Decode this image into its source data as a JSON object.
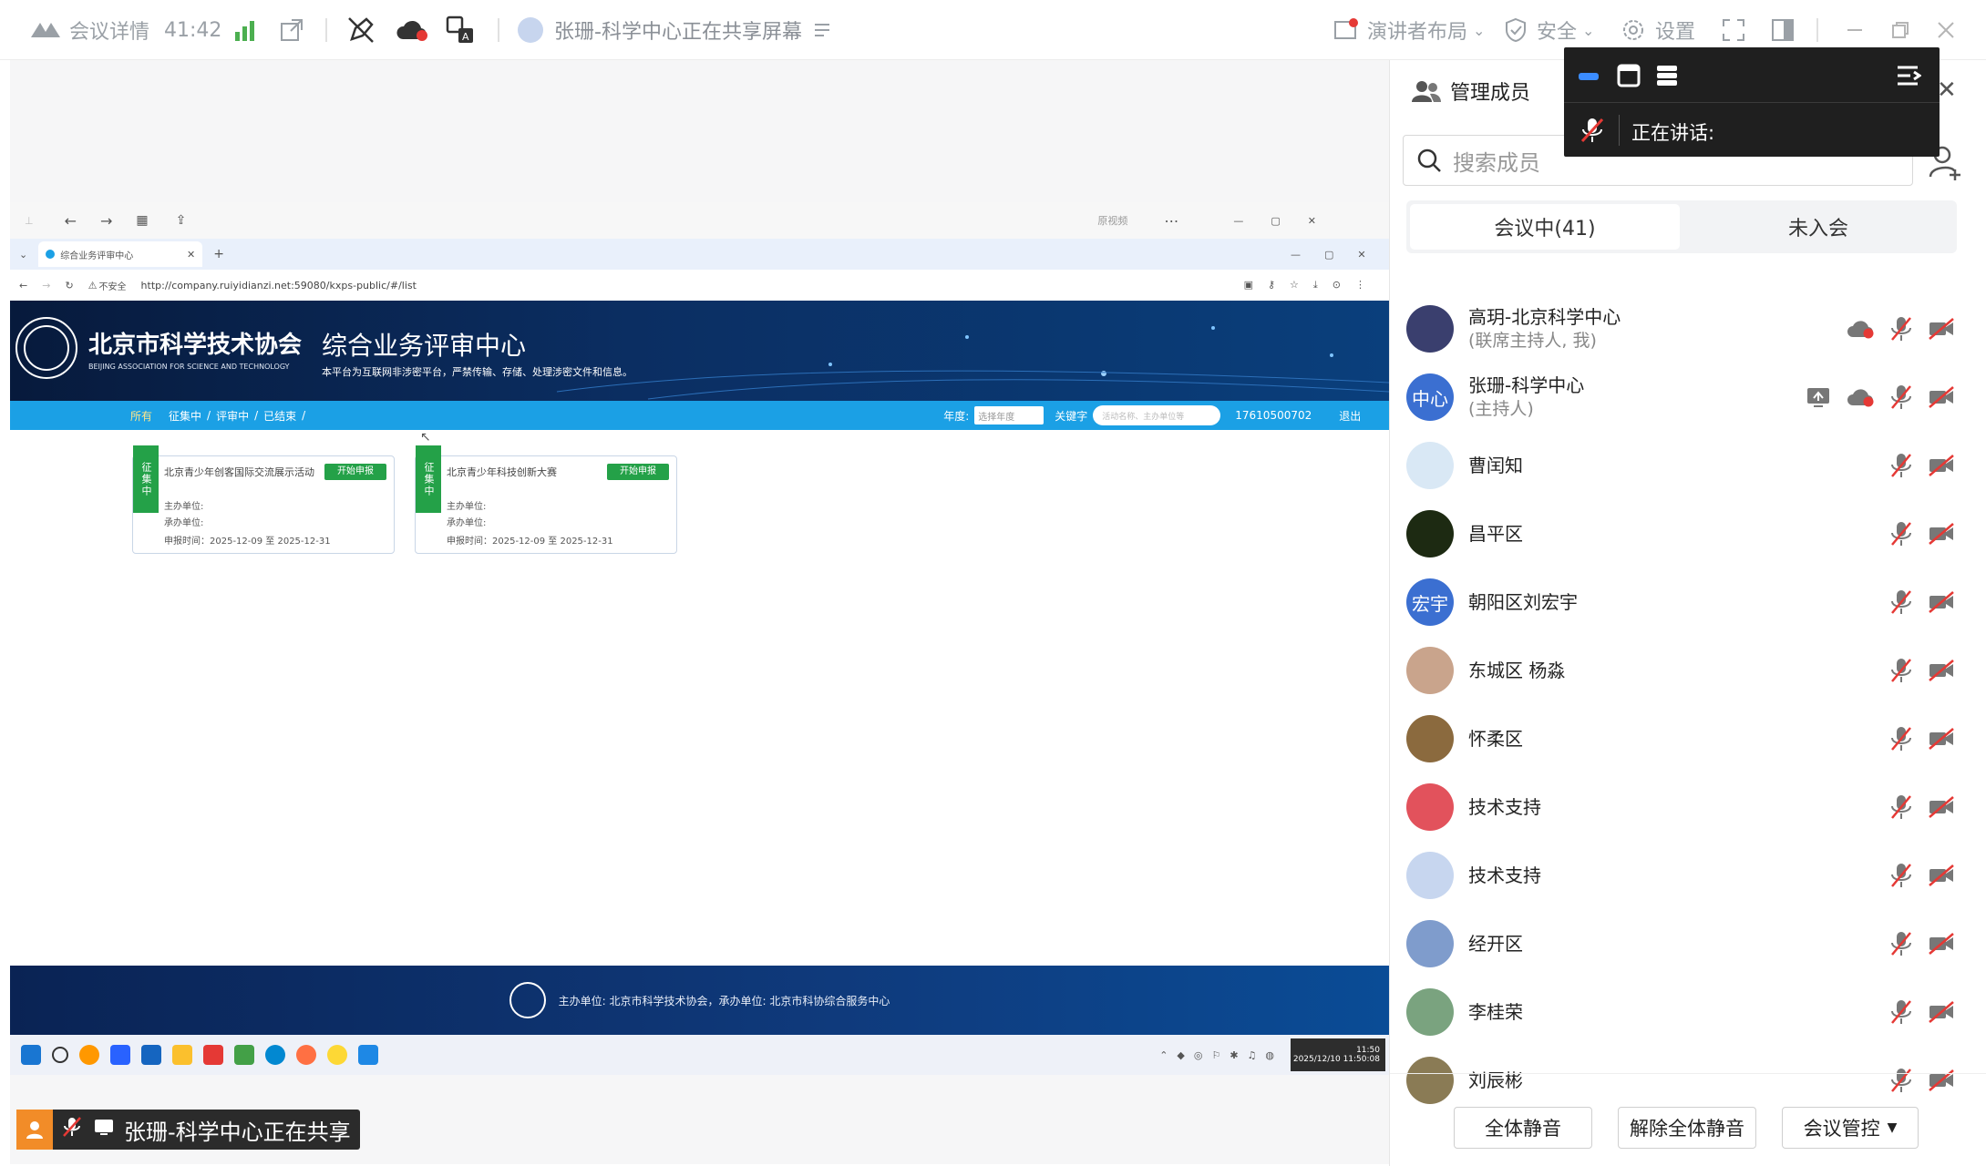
{
  "topbar": {
    "meeting_details": "会议详情",
    "timer": "41:42",
    "sharing_status": "张珊-科学中心正在共享屏幕",
    "presenter_layout": "演讲者布局",
    "security": "安全",
    "settings": "设置"
  },
  "browser": {
    "toolbar_text": "原视频",
    "tab_title": "综合业务评审中心",
    "address_insecure": "不安全",
    "url": "http://company.ruiyidianzi.net:59080/kxps-public/#/list"
  },
  "site": {
    "org_name_cn": "北京市科学技术协会",
    "org_name_en": "BEIJING ASSOCIATION FOR SCIENCE AND TECHNOLOGY",
    "title": "综合业务评审中心",
    "subtitle": "本平台为互联网非涉密平台，严禁传输、存储、处理涉密文件和信息。",
    "nav": [
      "所有",
      "征集中",
      "评审中",
      "已结束"
    ],
    "year_label": "年度:",
    "year_placeholder": "选择年度",
    "keyword_label": "关键字",
    "keyword_placeholder": "活动名称、主办单位等",
    "phone": "17610500702",
    "logout": "退出",
    "cards": [
      {
        "tag": "征集中",
        "title": "北京青少年创客国际交流展示活动",
        "button": "开始申报",
        "host": "主办单位:",
        "organizer": "承办单位:",
        "dates": "申报时间：2025-12-09 至 2025-12-31"
      },
      {
        "tag": "征集中",
        "title": "北京青少年科技创新大赛",
        "button": "开始申报",
        "host": "主办单位:",
        "organizer": "承办单位:",
        "dates": "申报时间：2025-12-09 至 2025-12-31"
      }
    ],
    "footer": "主办单位: 北京市科学技术协会，承办单位: 北京市科协综合服务中心"
  },
  "taskbar": {
    "time": "11:50",
    "date": "2025/12/10 11:50:08"
  },
  "share_tag": "张珊-科学中心正在共享",
  "panel": {
    "title": "管理成员",
    "search_placeholder": "搜索成员",
    "tab_in_meeting": "会议中(41)",
    "tab_not_joined": "未入会",
    "members": [
      {
        "name": "高玥-北京科学中心",
        "role": "(联席主持人, 我)",
        "avatar_text": "",
        "avatar_color": "#3a3f6e",
        "cloud": true,
        "share": false
      },
      {
        "name": "张珊-科学中心",
        "role": "(主持人)",
        "avatar_text": "中心",
        "avatar_color": "#3b6fd1",
        "cloud": true,
        "share": true
      },
      {
        "name": "曹闰知",
        "role": "",
        "avatar_text": "",
        "avatar_color": "#d9e8f5",
        "cloud": false,
        "share": false
      },
      {
        "name": "昌平区",
        "role": "",
        "avatar_text": "",
        "avatar_color": "#1d2a12",
        "cloud": false,
        "share": false
      },
      {
        "name": "朝阳区刘宏宇",
        "role": "",
        "avatar_text": "宏宇",
        "avatar_color": "#3b6fd1",
        "cloud": false,
        "share": false
      },
      {
        "name": "东城区 杨淼",
        "role": "",
        "avatar_text": "",
        "avatar_color": "#c9a48c",
        "cloud": false,
        "share": false
      },
      {
        "name": "怀柔区",
        "role": "",
        "avatar_text": "",
        "avatar_color": "#8b6a3e",
        "cloud": false,
        "share": false
      },
      {
        "name": "技术支持",
        "role": "",
        "avatar_text": "",
        "avatar_color": "#e2525c",
        "cloud": false,
        "share": false
      },
      {
        "name": "技术支持",
        "role": "",
        "avatar_text": "",
        "avatar_color": "#c7d6ef",
        "cloud": false,
        "share": false
      },
      {
        "name": "经开区",
        "role": "",
        "avatar_text": "",
        "avatar_color": "#7f9ccc",
        "cloud": false,
        "share": false
      },
      {
        "name": "李桂荣",
        "role": "",
        "avatar_text": "",
        "avatar_color": "#7aa37f",
        "cloud": false,
        "share": false
      },
      {
        "name": "刘辰彬",
        "role": "",
        "avatar_text": "",
        "avatar_color": "#8a7b55",
        "cloud": false,
        "share": false
      }
    ],
    "mute_all": "全体静音",
    "unmute_all": "解除全体静音",
    "meeting_control": "会议管控"
  },
  "speaker": {
    "speaking_label": "正在讲话:"
  },
  "colors": {
    "accent": "#3b6fd1",
    "muted_red": "#e53935",
    "site_blue": "#1ba0e5",
    "card_green": "#24a148"
  }
}
